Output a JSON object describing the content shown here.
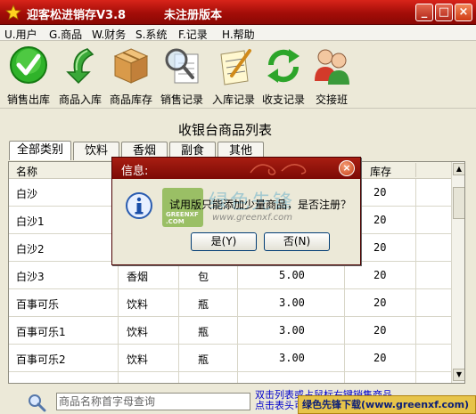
{
  "window": {
    "title": "迎客松进销存V3.8",
    "unregistered": "未注册版本",
    "min": "_",
    "max": "□",
    "close": "×"
  },
  "menu": [
    {
      "label": "U.用户"
    },
    {
      "label": "G.商品"
    },
    {
      "label": "W.财务"
    },
    {
      "label": "S.系统"
    },
    {
      "label": "F.记录"
    },
    {
      "label": "H.帮助"
    }
  ],
  "toolbar": [
    {
      "label": "销售出库",
      "icon": "check-icon"
    },
    {
      "label": "商品入库",
      "icon": "return-arrow-icon"
    },
    {
      "label": "商品库存",
      "icon": "box-icon"
    },
    {
      "label": "销售记录",
      "icon": "magnifier-document-icon"
    },
    {
      "label": "入库记录",
      "icon": "notepad-pen-icon"
    },
    {
      "label": "收支记录",
      "icon": "refresh-arrows-icon"
    },
    {
      "label": "交接班",
      "icon": "users-icon"
    }
  ],
  "panel": {
    "title": "收银台商品列表",
    "tabs": [
      "全部类别",
      "饮料",
      "香烟",
      "副食",
      "其他"
    ],
    "columns": [
      "名称",
      "库存"
    ],
    "rows": [
      {
        "name": "白沙",
        "type": "",
        "unit": "",
        "price": "",
        "stock": "20"
      },
      {
        "name": "白沙1",
        "type": "",
        "unit": "",
        "price": "",
        "stock": "20"
      },
      {
        "name": "白沙2",
        "type": "",
        "unit": "",
        "price": "",
        "stock": "20"
      },
      {
        "name": "白沙3",
        "type": "香烟",
        "unit": "包",
        "price": "5.00",
        "stock": "20"
      },
      {
        "name": "百事可乐",
        "type": "饮料",
        "unit": "瓶",
        "price": "3.00",
        "stock": "20"
      },
      {
        "name": "百事可乐1",
        "type": "饮料",
        "unit": "瓶",
        "price": "3.00",
        "stock": "20"
      },
      {
        "name": "百事可乐2",
        "type": "饮料",
        "unit": "瓶",
        "price": "3.00",
        "stock": "20"
      }
    ]
  },
  "bottom": {
    "search_placeholder": "商品名称首字母查询",
    "hint_line1": "双击列表或占鼠标右键销售商品",
    "hint_line2": "点击表头可以",
    "banner": "绿色先锋下载(www.greenxf.com)"
  },
  "dialog": {
    "title": "信息:",
    "message": "试用版只能添加少量商品，是否注册？",
    "yes": "是(Y)",
    "no": "否(N)",
    "close": "×"
  },
  "watermark": {
    "name": "绿色先锋",
    "url": "www.greenxf.com",
    "logo_text": "GREENXF .COM"
  },
  "colors": {
    "title_red": "#a30d08",
    "hint_blue": "#0000cc",
    "banner_gold": "#e7c44a"
  }
}
